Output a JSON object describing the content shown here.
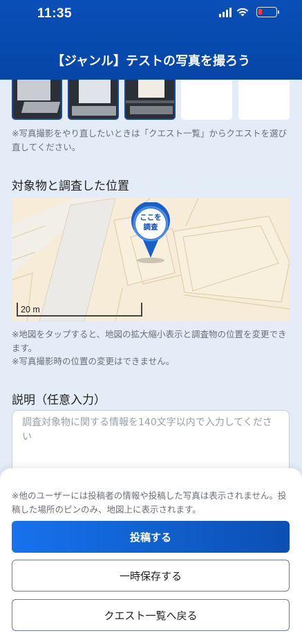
{
  "status_bar": {
    "time": "11:35",
    "icons": [
      "signal-icon",
      "wifi-icon",
      "battery-low-icon"
    ]
  },
  "header": {
    "title": "【ジャンル】テストの写真を撮ろう"
  },
  "photos": {
    "count_filled": 3,
    "count_empty": 2,
    "note": "※写真撮影をやり直したいときは「クエスト一覧」からクエストを選び直してください。"
  },
  "location": {
    "title": "対象物と調査した位置",
    "pin_label": "ここを調査",
    "scale_label": "20 m",
    "note_1": "※地図をタップすると、地図の拡大縮小表示と調査物の位置を変更できます。",
    "note_2": "※写真撮影時の位置の変更はできません。"
  },
  "description": {
    "title": "説明（任意入力）",
    "placeholder": "調査対象物に関する情報を140文字以内で入力してください",
    "value": ""
  },
  "sheet": {
    "note": "※他のユーザーには投稿者の情報や投稿した写真は表示されません。投稿した場所のピンのみ、地図上に表示されます。",
    "submit_label": "投稿する",
    "save_label": "一時保存する",
    "back_label": "クエスト一覧へ戻る"
  },
  "colors": {
    "header_bg": "#0546a6",
    "primary": "#1672ee",
    "page_bg": "#e4ecf7",
    "map_bg": "#f6ecd7",
    "battery_low": "#ff3b30"
  }
}
